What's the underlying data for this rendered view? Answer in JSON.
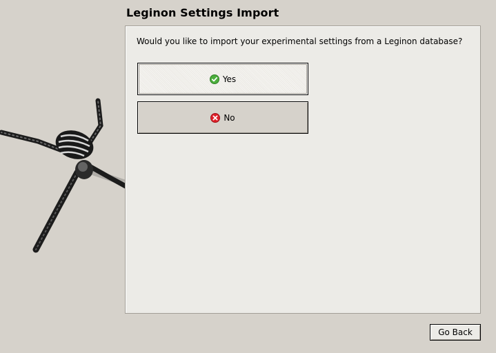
{
  "header": {
    "title": "Leginon Settings Import"
  },
  "dialog": {
    "question": "Would you like to import your experimental settings from a Leginon database?",
    "yes_label": "Yes",
    "no_label": "No"
  },
  "footer": {
    "go_back_label": "Go Back"
  },
  "icons": {
    "yes": "check-circle-icon",
    "no": "x-circle-icon",
    "decoration": "spider-icon"
  },
  "colors": {
    "background": "#d6d2cb",
    "panel": "#ecebe7",
    "yes_icon": "#4caf3d",
    "no_icon": "#e0202a"
  }
}
